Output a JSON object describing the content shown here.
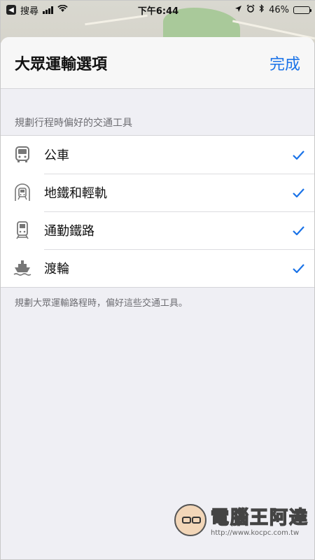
{
  "status_bar": {
    "back_app": "搜尋",
    "time": "下午6:44",
    "battery": "46%",
    "battery_level": 0.46
  },
  "nav": {
    "title": "大眾運輸選項",
    "done": "完成"
  },
  "section": {
    "header": "規劃行程時偏好的交通工具",
    "items": [
      {
        "label": "公車",
        "icon": "bus-icon",
        "checked": true
      },
      {
        "label": "地鐵和輕軌",
        "icon": "subway-icon",
        "checked": true
      },
      {
        "label": "通勤鐵路",
        "icon": "train-icon",
        "checked": true
      },
      {
        "label": "渡輪",
        "icon": "ferry-icon",
        "checked": true
      }
    ],
    "footer": "規劃大眾運輸路程時，偏好這些交通工具。"
  },
  "watermark": {
    "brand": "電腦王阿達",
    "url": "http://www.kocpc.com.tw"
  },
  "colors": {
    "accent": "#1a73e8",
    "background": "#efeff4"
  }
}
